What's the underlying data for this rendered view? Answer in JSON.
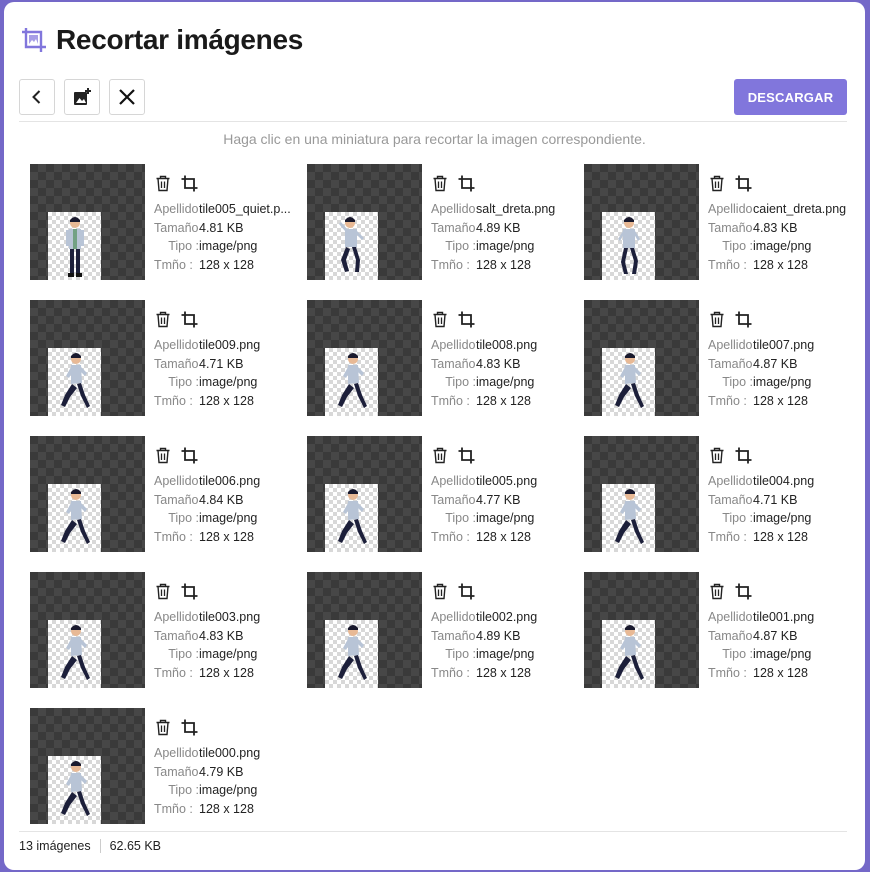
{
  "header": {
    "title": "Recortar imágenes"
  },
  "toolbar": {
    "download_label": "DESCARGAR"
  },
  "hint": "Haga clic en una miniatura para recortar la imagen correspondiente.",
  "labels": {
    "name": "Apellido",
    "size": "Tamaño",
    "type": "Tipo :",
    "dims": "Tmño :"
  },
  "images": [
    {
      "name": "tile005_quiet.p...",
      "size": "4.81 KB",
      "type": "image/png",
      "dims": "128 x 128",
      "pose": "stand"
    },
    {
      "name": "salt_dreta.png",
      "size": "4.89 KB",
      "type": "image/png",
      "dims": "128 x 128",
      "pose": "jump"
    },
    {
      "name": "caient_dreta.png",
      "size": "4.83 KB",
      "type": "image/png",
      "dims": "128 x 128",
      "pose": "fall"
    },
    {
      "name": "tile009.png",
      "size": "4.71 KB",
      "type": "image/png",
      "dims": "128 x 128",
      "pose": "run"
    },
    {
      "name": "tile008.png",
      "size": "4.83 KB",
      "type": "image/png",
      "dims": "128 x 128",
      "pose": "run"
    },
    {
      "name": "tile007.png",
      "size": "4.87 KB",
      "type": "image/png",
      "dims": "128 x 128",
      "pose": "run"
    },
    {
      "name": "tile006.png",
      "size": "4.84 KB",
      "type": "image/png",
      "dims": "128 x 128",
      "pose": "run"
    },
    {
      "name": "tile005.png",
      "size": "4.77 KB",
      "type": "image/png",
      "dims": "128 x 128",
      "pose": "run"
    },
    {
      "name": "tile004.png",
      "size": "4.71 KB",
      "type": "image/png",
      "dims": "128 x 128",
      "pose": "run"
    },
    {
      "name": "tile003.png",
      "size": "4.83 KB",
      "type": "image/png",
      "dims": "128 x 128",
      "pose": "run"
    },
    {
      "name": "tile002.png",
      "size": "4.89 KB",
      "type": "image/png",
      "dims": "128 x 128",
      "pose": "run"
    },
    {
      "name": "tile001.png",
      "size": "4.87 KB",
      "type": "image/png",
      "dims": "128 x 128",
      "pose": "run"
    },
    {
      "name": "tile000.png",
      "size": "4.79 KB",
      "type": "image/png",
      "dims": "128 x 128",
      "pose": "run"
    }
  ],
  "footer": {
    "count": "13 imágenes",
    "total": "62.65 KB"
  },
  "colors": {
    "accent": "#8176dc",
    "background": "#7468c8"
  }
}
